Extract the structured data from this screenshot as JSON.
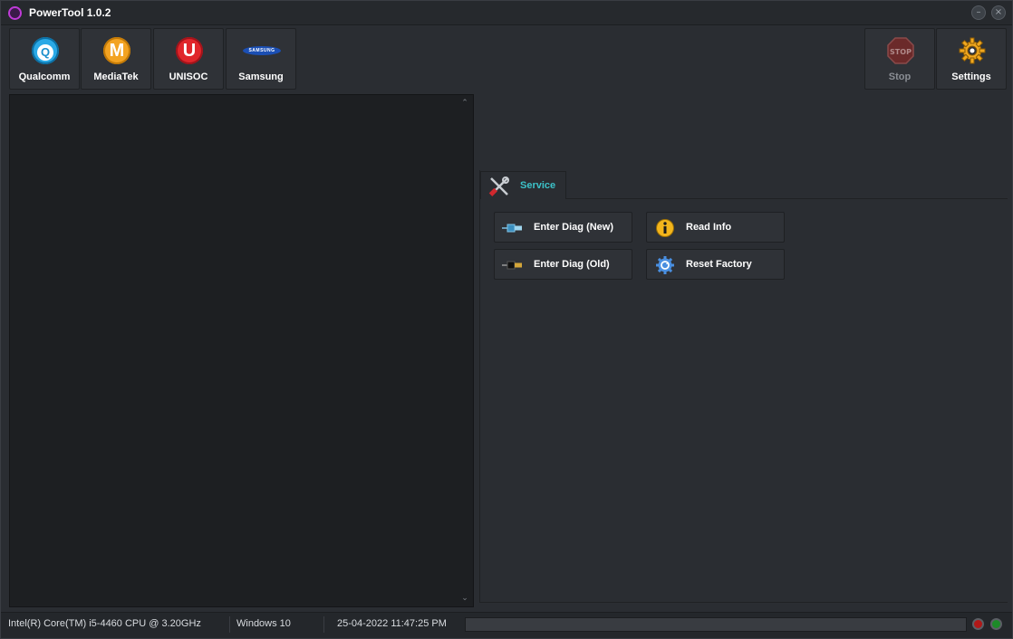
{
  "app": {
    "title": "PowerTool 1.0.2"
  },
  "window_controls": {
    "minimize": "–",
    "close": "×"
  },
  "toolbar": {
    "qualcomm": {
      "label": "Qualcomm",
      "icon": "qualcomm-icon",
      "glyph": "Q",
      "color": "#2aa9e6"
    },
    "mediatek": {
      "label": "MediaTek",
      "icon": "mediatek-icon",
      "glyph": "M",
      "color": "#f3a322"
    },
    "unisoc": {
      "label": "UNISOC",
      "icon": "unisoc-icon",
      "glyph": "U",
      "color": "#e0262b"
    },
    "samsung": {
      "label": "Samsung",
      "icon": "samsung-logo-icon",
      "glyph": "SAMSUNG",
      "color": "#1b4fb4"
    },
    "stop": {
      "label": "Stop",
      "icon": "stop-sign-icon",
      "glyph": "STOP",
      "enabled": false
    },
    "settings": {
      "label": "Settings",
      "icon": "gear-icon"
    }
  },
  "log": {
    "scroll_up": "⌃",
    "scroll_down": "⌄"
  },
  "tabs": [
    {
      "label": "Service",
      "icon": "tools-icon",
      "active": true
    }
  ],
  "service": {
    "enter_diag_new": {
      "label": "Enter Diag (New)",
      "icon": "usb-cable-new-icon"
    },
    "enter_diag_old": {
      "label": "Enter Diag (Old)",
      "icon": "usb-cable-old-icon"
    },
    "read_info": {
      "label": "Read Info",
      "icon": "info-icon"
    },
    "reset_factory": {
      "label": "Reset Factory",
      "icon": "reset-gear-icon"
    }
  },
  "status": {
    "cpu": "Intel(R) Core(TM) i5-4460  CPU @ 3.20GHz",
    "os": "Windows 10",
    "datetime": "25-04-2022 11:47:25 PM",
    "progress": 0,
    "led_error": "#b01818",
    "led_ok": "#1d8a28"
  },
  "colors": {
    "accent": "#3cc2c9",
    "background": "#2a2d32",
    "log_background": "#1d1f22"
  }
}
